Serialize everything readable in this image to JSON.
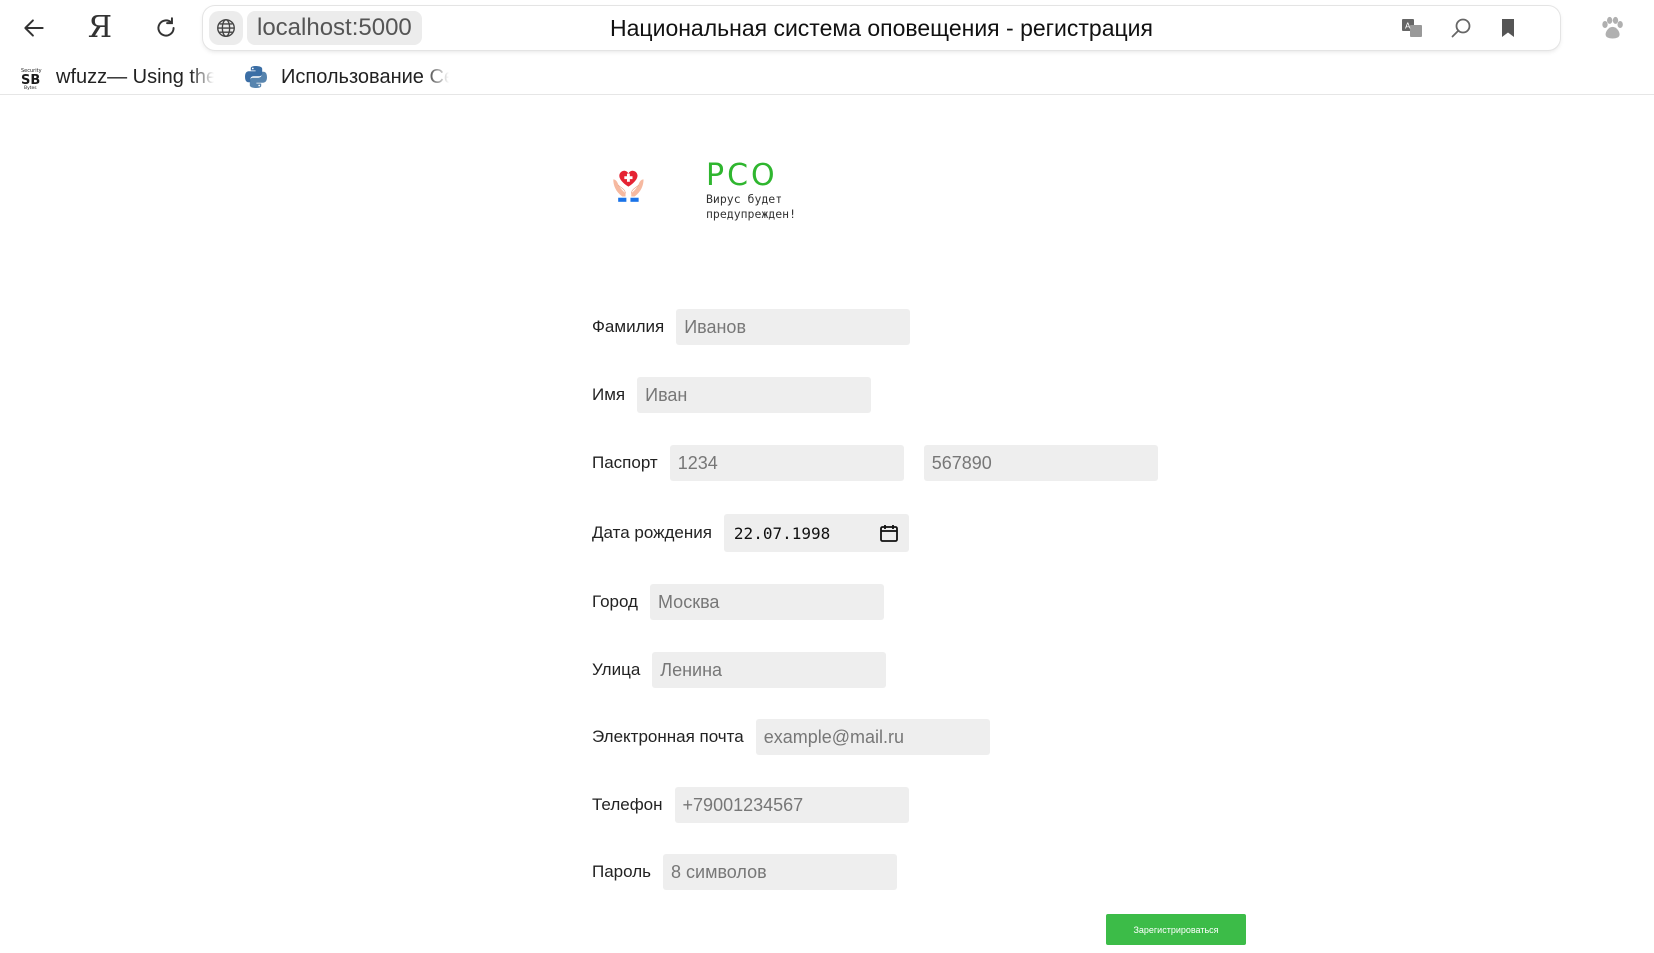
{
  "browser": {
    "url": "localhost:5000",
    "tab_title": "Национальная система оповещения - регистрация",
    "yandex_glyph": "Я",
    "bookmarks": [
      {
        "label": "wfuzz— Using the",
        "icon": "security-bytes-icon"
      },
      {
        "label": "Использование Ce",
        "icon": "python-icon"
      }
    ]
  },
  "logo": {
    "name": "РСО",
    "tagline_line1": "Вирус будет",
    "tagline_line2": "предупрежден!",
    "accent_color": "#2fb62f"
  },
  "form": {
    "surname": {
      "label": "Фамилия",
      "placeholder": "Иванов"
    },
    "name": {
      "label": "Имя",
      "placeholder": "Иван"
    },
    "passport": {
      "label": "Паспорт",
      "series_placeholder": "1234",
      "number_placeholder": "567890"
    },
    "birth_date": {
      "label": "Дата рождения",
      "value": "22.07.1998"
    },
    "city": {
      "label": "Город",
      "placeholder": "Москва"
    },
    "street": {
      "label": "Улица",
      "placeholder": "Ленина"
    },
    "email": {
      "label": "Электронная почта",
      "placeholder": "example@mail.ru"
    },
    "phone": {
      "label": "Телефон",
      "placeholder": "+79001234567"
    },
    "password": {
      "label": "Пароль",
      "placeholder": "8 символов"
    },
    "submit_label": "Зарегистрироваться",
    "submit_color": "#3cbc48"
  }
}
